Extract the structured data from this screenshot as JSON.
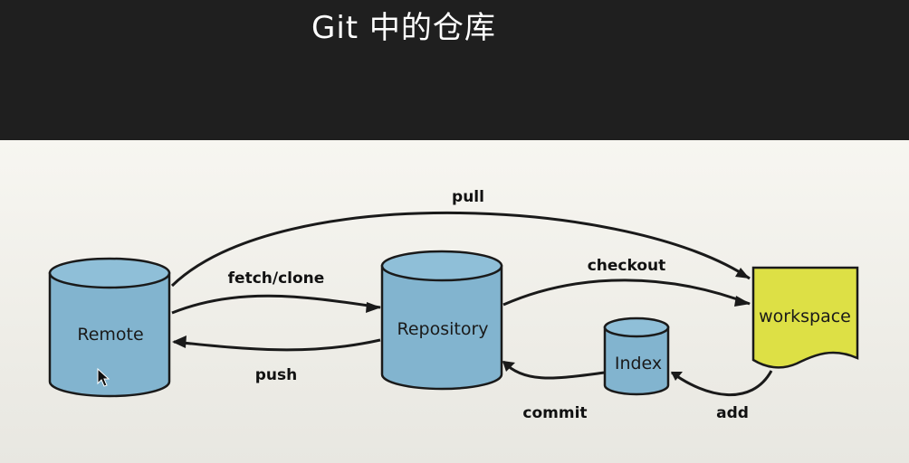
{
  "title": "Git 中的仓库",
  "colors": {
    "top_bar": "#1f1f1f",
    "slide_background": "#f2f1ec",
    "cylinder_fill": "#82b4cf",
    "workspace_fill": "#dde045",
    "stroke": "#1a1a1a"
  },
  "nodes": {
    "remote": "Remote",
    "repository": "Repository",
    "index": "Index",
    "workspace": "workspace"
  },
  "edges": {
    "pull": "pull",
    "fetch_clone": "fetch/clone",
    "push": "push",
    "checkout": "checkout",
    "commit": "commit",
    "add": "add"
  },
  "icons": {
    "cursor": "mouse-pointer-icon"
  }
}
